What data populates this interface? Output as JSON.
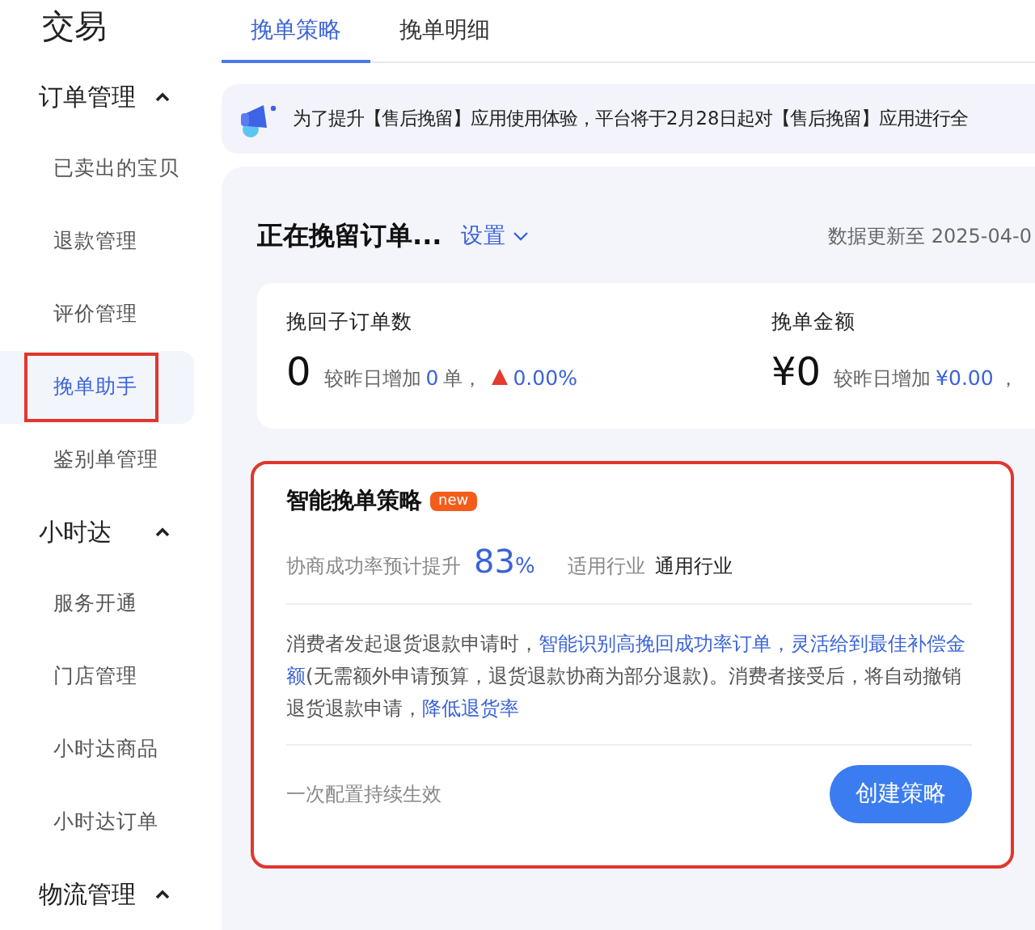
{
  "sidebar": {
    "title": "交易",
    "groups": [
      {
        "label": "订单管理",
        "expanded": true,
        "items": [
          {
            "label": "已卖出的宝贝",
            "selected": false,
            "highlighted": false
          },
          {
            "label": "退款管理",
            "selected": false,
            "highlighted": false
          },
          {
            "label": "评价管理",
            "selected": false,
            "highlighted": false
          },
          {
            "label": "挽单助手",
            "selected": true,
            "highlighted": true
          },
          {
            "label": "鉴别单管理",
            "selected": false,
            "highlighted": false
          }
        ]
      },
      {
        "label": "小时达",
        "expanded": true,
        "items": [
          {
            "label": "服务开通",
            "selected": false,
            "highlighted": false
          },
          {
            "label": "门店管理",
            "selected": false,
            "highlighted": false
          },
          {
            "label": "小时达商品",
            "selected": false,
            "highlighted": false
          },
          {
            "label": "小时达订单",
            "selected": false,
            "highlighted": false
          }
        ]
      },
      {
        "label": "物流管理",
        "expanded": true
      }
    ]
  },
  "tabs": [
    {
      "label": "挽单策略",
      "selected": true
    },
    {
      "label": "挽单明细",
      "selected": false
    }
  ],
  "notice": "为了提升【售后挽留】应用使用体验，平台将于2月28日起对【售后挽留】应用进行全",
  "panel": {
    "title": "正在挽留订单...",
    "settings_link": "设置",
    "updated": "数据更新至 2025-04-0",
    "stats": [
      {
        "label": "挽回子订单数",
        "value": "0",
        "delta_prefix": "较昨日增加",
        "delta_value": "0",
        "delta_suffix": "单，",
        "rising": true,
        "change": "0.00%"
      },
      {
        "label": "挽单金额",
        "value": "¥0",
        "delta_prefix": "较昨日增加",
        "delta_value": "¥0.00",
        "delta_suffix": "，"
      }
    ],
    "strategy": {
      "title": "智能挽单策略",
      "badge": "new",
      "highlighted": true,
      "rate_label": "协商成功率预计提升",
      "rate_value": "83",
      "rate_unit": "%",
      "industry_label": "适用行业",
      "industry_value": "通用行业",
      "description": [
        {
          "text": "消费者发起退货退款申请时，",
          "link": false
        },
        {
          "text": "智能识别高挽回成功率订单，灵活给到最佳补偿金额",
          "link": true
        },
        {
          "text": "(无需额外申请预算，退货退款协商为部分退款)。消费者接受后，将自动撤销退货退款申请，",
          "link": false
        },
        {
          "text": "降低退货率",
          "link": true
        }
      ],
      "footer_note": "一次配置持续生效",
      "button": "创建策略"
    }
  }
}
